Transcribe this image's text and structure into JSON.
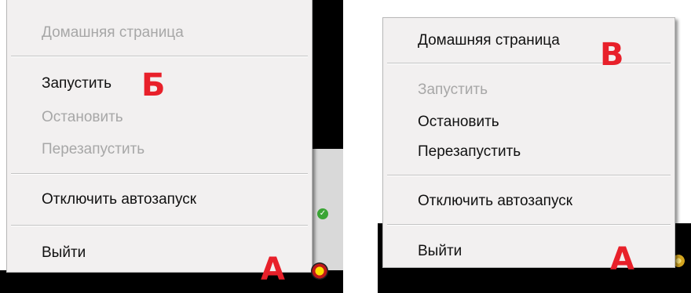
{
  "left_menu": {
    "items": [
      {
        "label": "Домашняя страница",
        "enabled": false
      },
      {
        "label": "Запустить",
        "enabled": true
      },
      {
        "label": "Остановить",
        "enabled": false
      },
      {
        "label": "Перезапустить",
        "enabled": false
      },
      {
        "label": "Отключить автозапуск",
        "enabled": true
      },
      {
        "label": "Выйти",
        "enabled": true
      }
    ]
  },
  "right_menu": {
    "items": [
      {
        "label": "Домашняя страница",
        "enabled": true
      },
      {
        "label": "Запустить",
        "enabled": false
      },
      {
        "label": "Остановить",
        "enabled": true
      },
      {
        "label": "Перезапустить",
        "enabled": true
      },
      {
        "label": "Отключить автозапуск",
        "enabled": true
      },
      {
        "label": "Выйти",
        "enabled": true
      }
    ]
  },
  "annotations": {
    "left_b": "Б",
    "left_a": "А",
    "right_v": "В",
    "right_a": "А"
  },
  "colors": {
    "annotation": "#e8202a",
    "menu_background": "#f2f0f0",
    "disabled_text": "#a7a7a7"
  },
  "icons": {
    "tray_app": "tray-app-icon",
    "status_ok": "check-icon",
    "gear": "gear-icon"
  }
}
